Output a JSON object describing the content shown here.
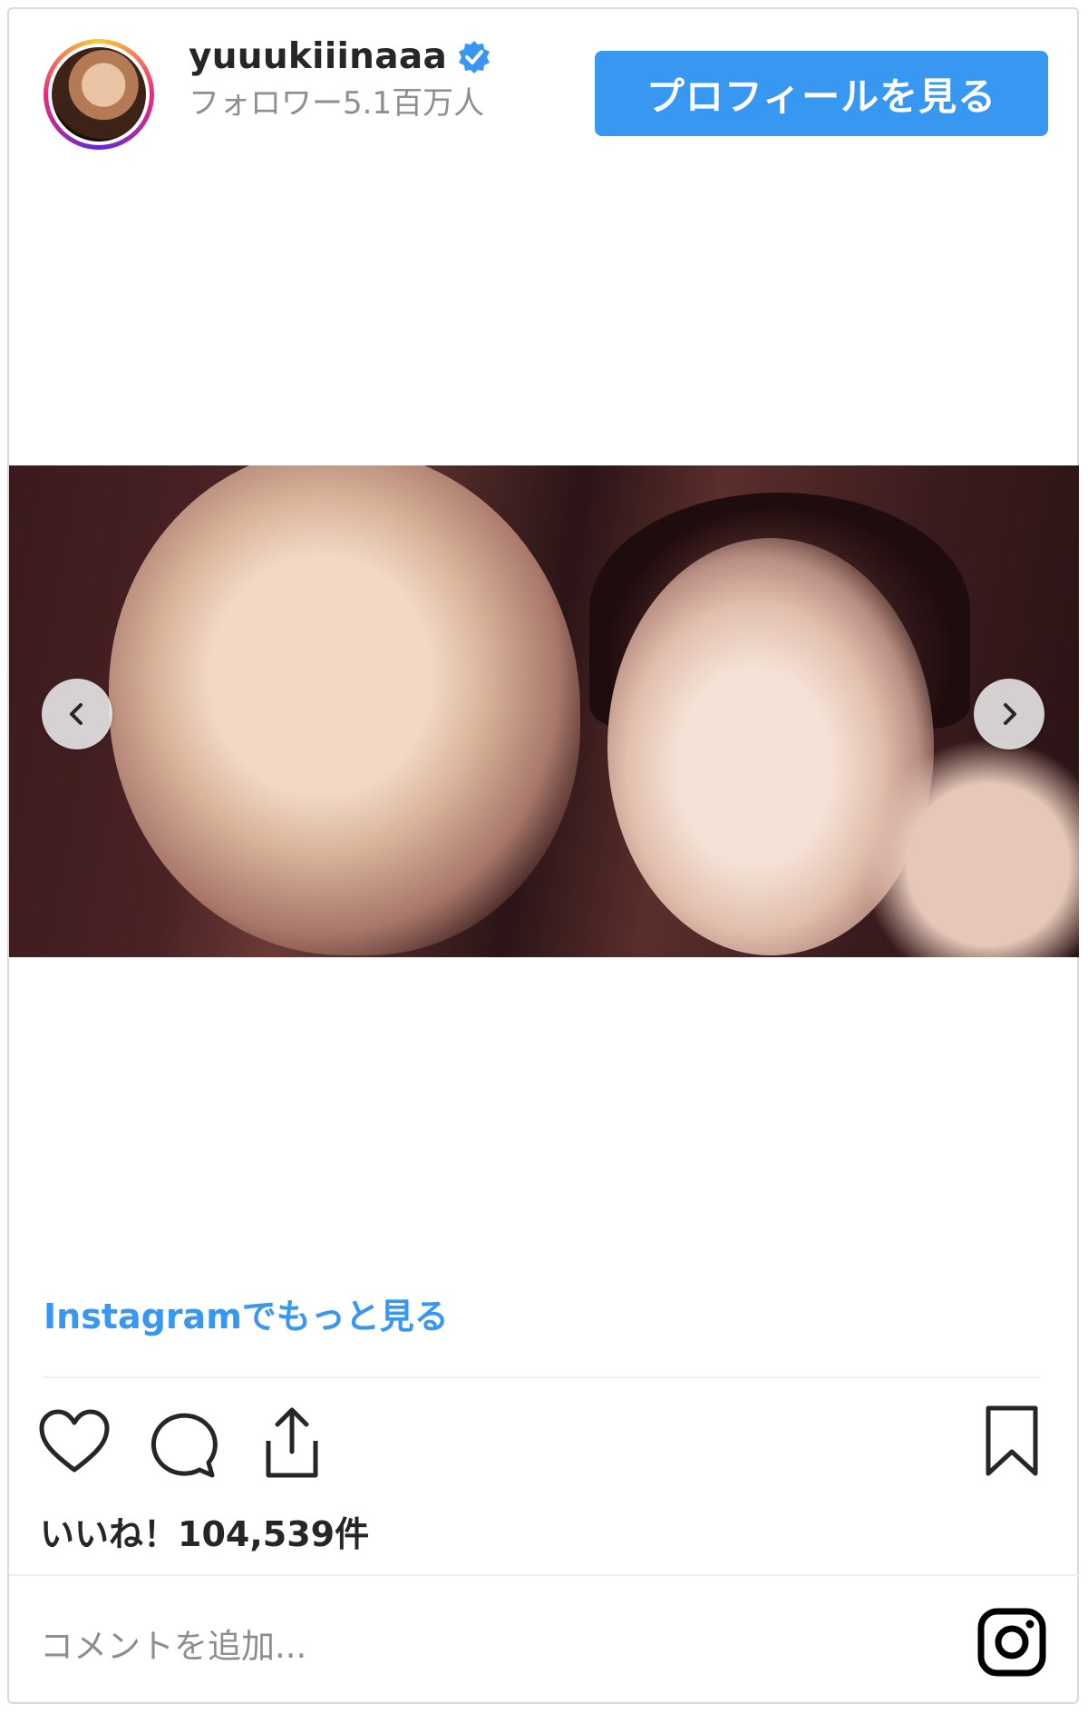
{
  "header": {
    "username": "yuuukiiinaaa",
    "followers": "フォロワー5.1百万人",
    "profile_button": "プロフィールを見る"
  },
  "media": {
    "icons": {
      "prev": "chevron-left-icon",
      "next": "chevron-right-icon"
    }
  },
  "more_link": "Instagramでもっと見る",
  "actions": {
    "icons": [
      "heart-icon",
      "comment-icon",
      "share-icon",
      "bookmark-icon"
    ]
  },
  "likes": "いいね！104,539件",
  "comment": {
    "placeholder": "コメントを追加..."
  },
  "colors": {
    "accent": "#3897f0",
    "text": "#262626",
    "muted": "#8e8e8e"
  }
}
